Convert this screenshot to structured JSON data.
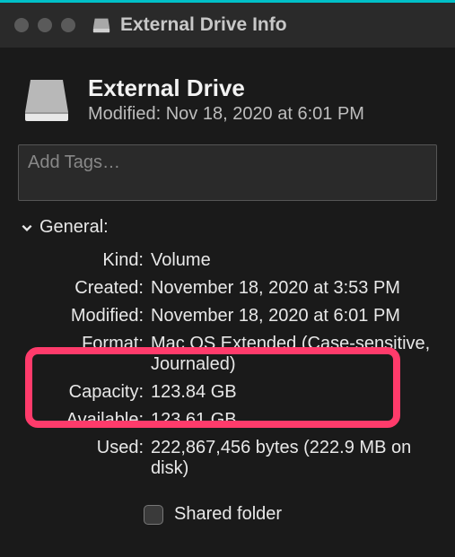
{
  "window": {
    "title": "External Drive Info"
  },
  "drive": {
    "name": "External Drive",
    "modified": "Modified: Nov 18, 2020 at 6:01 PM"
  },
  "tags": {
    "placeholder": "Add Tags…"
  },
  "section": {
    "general_label": "General:"
  },
  "general": {
    "kind_label": "Kind:",
    "kind_value": "Volume",
    "created_label": "Created:",
    "created_value": "November 18, 2020 at 3:53 PM",
    "modified_label": "Modified:",
    "modified_value": "November 18, 2020 at 6:01 PM",
    "format_label": "Format:",
    "format_value": "Mac OS Extended (Case-sensitive, Journaled)",
    "capacity_label": "Capacity:",
    "capacity_value": "123.84 GB",
    "available_label": "Available:",
    "available_value": "123.61 GB",
    "used_label": "Used:",
    "used_value": "222,867,456 bytes (222.9 MB on disk)"
  },
  "shared": {
    "label": "Shared folder"
  }
}
